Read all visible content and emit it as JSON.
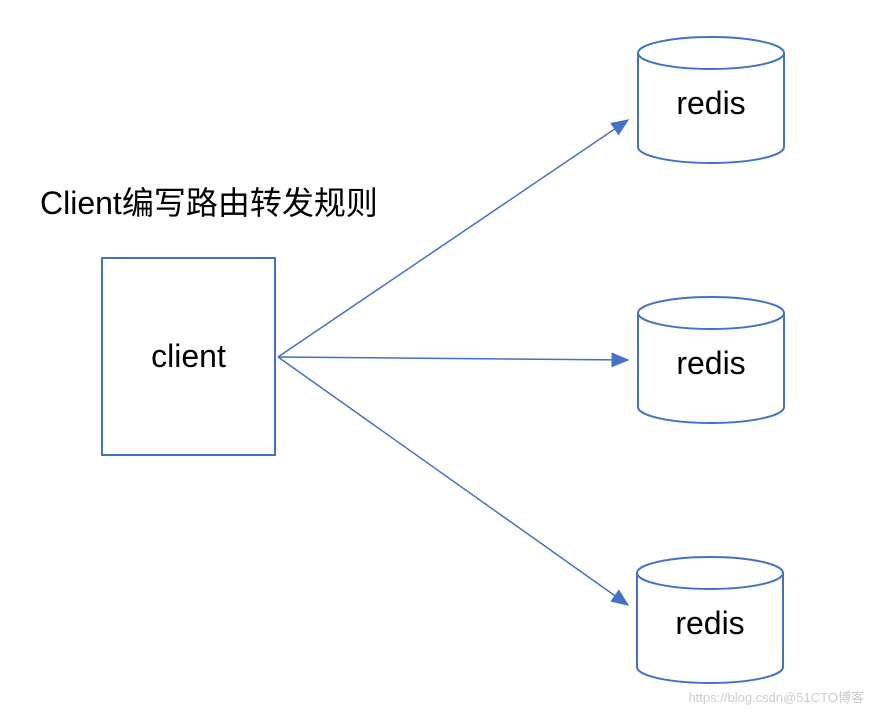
{
  "title": "Client编写路由转发规则",
  "client": {
    "label": "client"
  },
  "redis_nodes": [
    {
      "label": "redis"
    },
    {
      "label": "redis"
    },
    {
      "label": "redis"
    }
  ],
  "colors": {
    "stroke": "#4472C4",
    "text": "#000000"
  },
  "watermark": "https://blog.csdn@51CTO博客"
}
